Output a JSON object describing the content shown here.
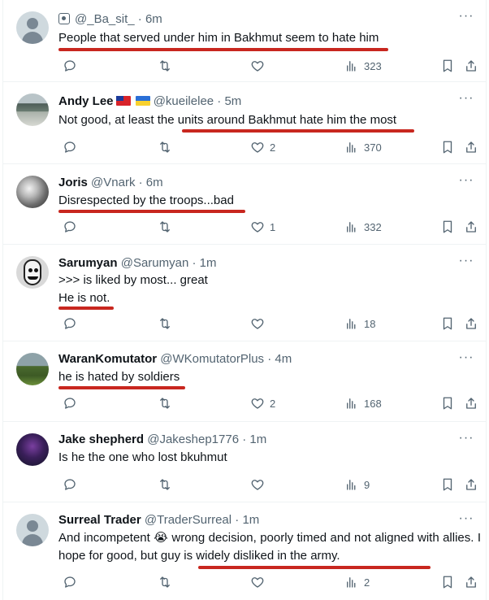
{
  "tweets": [
    {
      "avatar": "default-avatar",
      "name": "",
      "badge_icon": "identity-badge-icon",
      "handle": "@_Ba_sit_",
      "time": "6m",
      "lines": [
        "People that served under him in Bakhmut seem to hate him"
      ],
      "replies": "",
      "retweets": "",
      "likes": "",
      "views": "323"
    },
    {
      "avatar": "photo-avatar",
      "name": "Andy Lee",
      "flags": [
        "taiwan-flag-icon",
        "ukraine-flag-icon"
      ],
      "handle": "@kueilelee",
      "time": "5m",
      "lines": [
        "Not good, at least the units around Bakhmut hate him the most"
      ],
      "replies": "",
      "retweets": "",
      "likes": "2",
      "views": "370"
    },
    {
      "avatar": "photo-avatar",
      "name": "Joris",
      "handle": "@Vnark",
      "time": "6m",
      "lines": [
        "Disrespected by the troops...bad"
      ],
      "replies": "",
      "retweets": "",
      "likes": "1",
      "views": "332"
    },
    {
      "avatar": "face-avatar",
      "name": "Sarumyan",
      "handle": "@Sarumyan",
      "time": "1m",
      "lines": [
        ">>> is liked by most... great",
        "He is not."
      ],
      "replies": "",
      "retweets": "",
      "likes": "",
      "views": "18"
    },
    {
      "avatar": "photo-avatar",
      "name": "WaranKomutator",
      "handle": "@WKomutatorPlus",
      "time": "4m",
      "lines": [
        "he is hated by soldiers"
      ],
      "replies": "",
      "retweets": "",
      "likes": "2",
      "views": "168"
    },
    {
      "avatar": "photo-avatar",
      "name": "Jake shepherd",
      "handle": "@Jakeshep1776",
      "time": "1m",
      "lines": [
        "Is he the one who lost bkuhmut"
      ],
      "replies": "",
      "retweets": "",
      "likes": "",
      "views": "9"
    },
    {
      "avatar": "default-avatar",
      "name": "Surreal Trader",
      "handle": "@TraderSurreal",
      "time": "1m",
      "lines": [
        "And incompetent 😭 wrong decision, poorly timed and not aligned with allies. I hope for good,  but guy is widely disliked in the army."
      ],
      "replies": "",
      "retweets": "",
      "likes": "",
      "views": "2"
    }
  ],
  "separator": "·",
  "more_label": "···",
  "colors": {
    "underline": "#c8271f",
    "muted": "#536471",
    "text": "#0f1419",
    "border": "#eff3f4"
  }
}
